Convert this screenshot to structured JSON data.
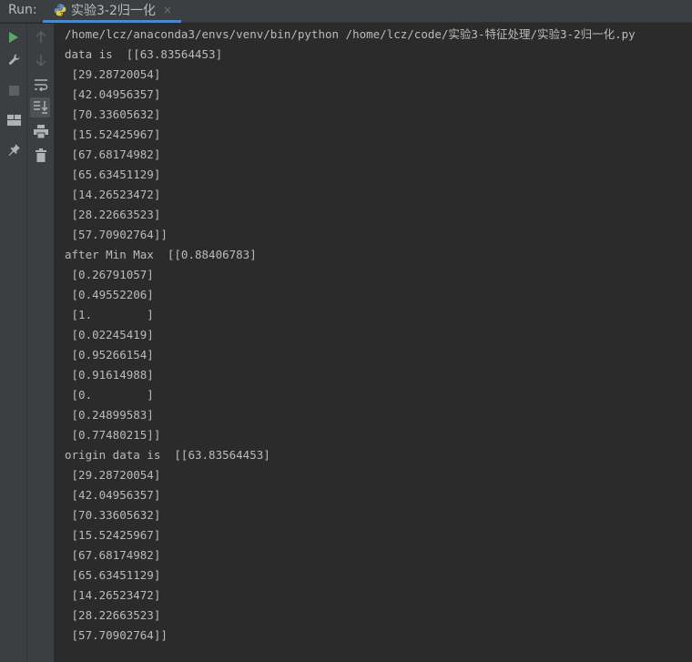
{
  "run": {
    "label": "Run:"
  },
  "tab": {
    "title": "实验3-2归一化",
    "close": "×"
  },
  "console": {
    "command": "/home/lcz/anaconda3/envs/venv/bin/python /home/lcz/code/实验3-特征处理/实验3-2归一化.py",
    "data_header": "data is  [[63.83564453]",
    "data_rows": [
      " [29.28720054]",
      " [42.04956357]",
      " [70.33605632]",
      " [15.52425967]",
      " [67.68174982]",
      " [65.63451129]",
      " [14.26523472]",
      " [28.22663523]",
      " [57.70902764]]"
    ],
    "minmax_header": "after Min Max  [[0.88406783]",
    "minmax_rows": [
      " [0.26791057]",
      " [0.49552206]",
      " [1.        ]",
      " [0.02245419]",
      " [0.95266154]",
      " [0.91614988]",
      " [0.        ]",
      " [0.24899583]",
      " [0.77480215]]"
    ],
    "origin_header": "origin data is  [[63.83564453]",
    "origin_rows": [
      " [29.28720054]",
      " [42.04956357]",
      " [70.33605632]",
      " [15.52425967]",
      " [67.68174982]",
      " [65.63451129]",
      " [14.26523472]",
      " [28.22663523]",
      " [57.70902764]]"
    ]
  },
  "icons": {
    "left": [
      "run-icon",
      "wrench-icon",
      "stop-icon",
      "layout-icon",
      "pin-icon"
    ],
    "tools": [
      "arrow-up-icon",
      "arrow-down-icon",
      "soft-wrap-icon",
      "scroll-to-end-icon",
      "print-icon",
      "trash-icon"
    ]
  },
  "colors": {
    "background": "#2b2b2b",
    "panel": "#3c3f41",
    "text": "#bbbbbb",
    "run_green": "#59a869",
    "tab_underline": "#4a88c7"
  }
}
